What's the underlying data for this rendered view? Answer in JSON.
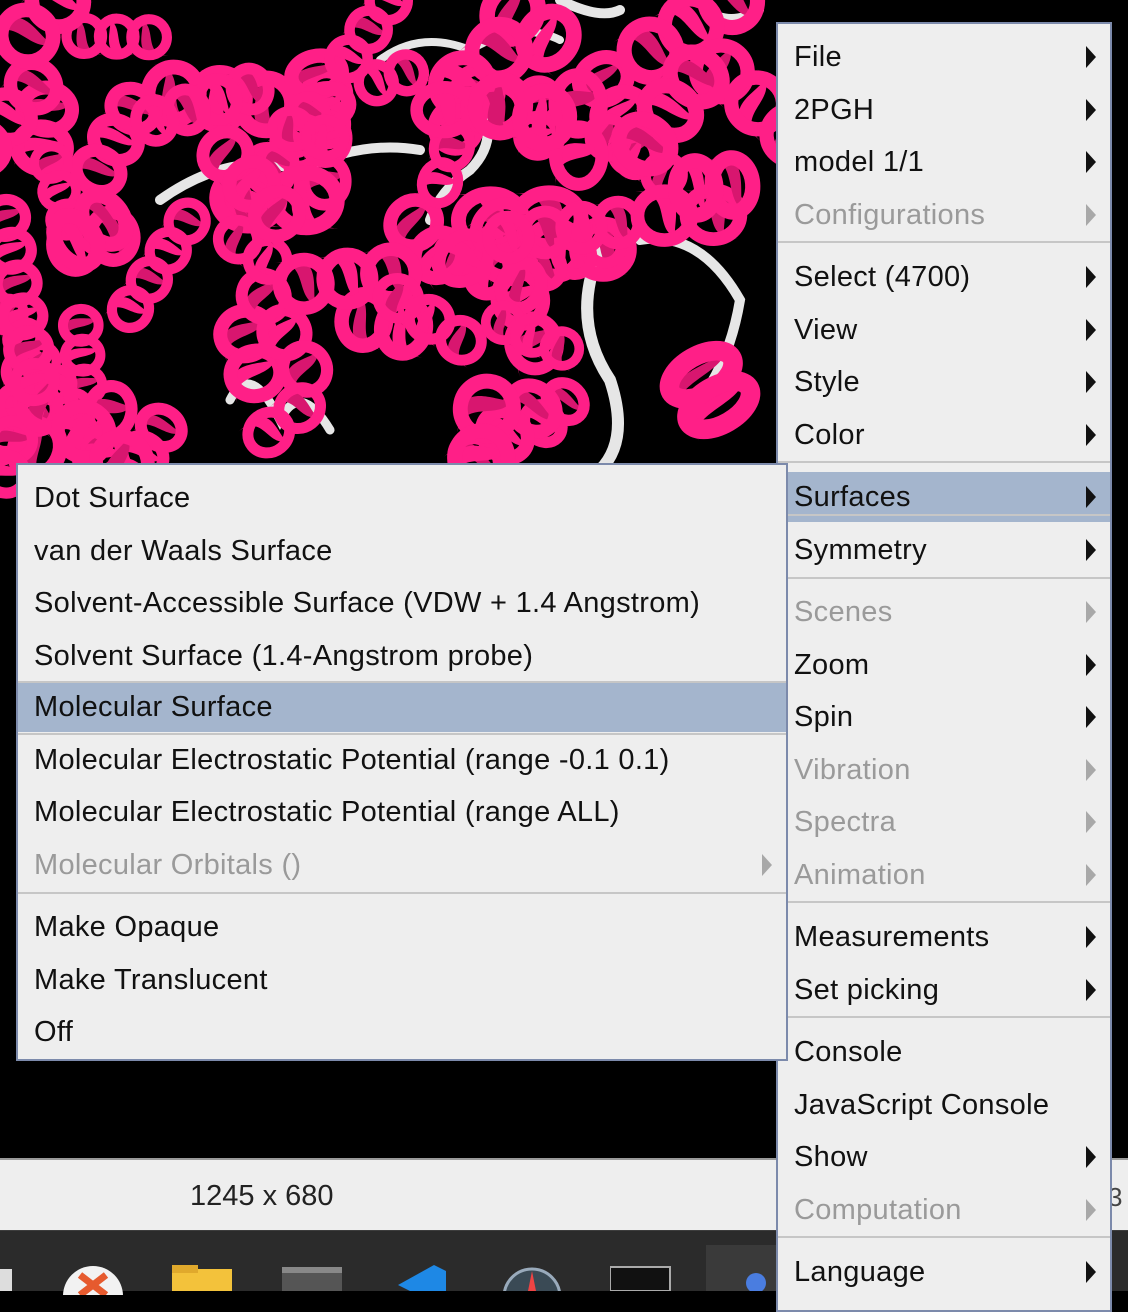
{
  "main_menu": {
    "items": [
      {
        "label": "File",
        "submenu": true,
        "enabled": true
      },
      {
        "label": "2PGH",
        "submenu": true,
        "enabled": true
      },
      {
        "label": "model 1/1",
        "submenu": true,
        "enabled": true
      },
      {
        "label": "Configurations",
        "submenu": true,
        "enabled": false
      },
      {
        "label": "Select (4700)",
        "submenu": true,
        "enabled": true
      },
      {
        "label": "View",
        "submenu": true,
        "enabled": true
      },
      {
        "label": "Style",
        "submenu": true,
        "enabled": true
      },
      {
        "label": "Color",
        "submenu": true,
        "enabled": true
      },
      {
        "label": "Surfaces",
        "submenu": true,
        "enabled": true,
        "highlighted": true
      },
      {
        "label": "Symmetry",
        "submenu": true,
        "enabled": true
      },
      {
        "label": "Scenes",
        "submenu": true,
        "enabled": false
      },
      {
        "label": "Zoom",
        "submenu": true,
        "enabled": true
      },
      {
        "label": "Spin",
        "submenu": true,
        "enabled": true
      },
      {
        "label": "Vibration",
        "submenu": true,
        "enabled": false
      },
      {
        "label": "Spectra",
        "submenu": true,
        "enabled": false
      },
      {
        "label": "Animation",
        "submenu": true,
        "enabled": false
      },
      {
        "label": "Measurements",
        "submenu": true,
        "enabled": true
      },
      {
        "label": "Set picking",
        "submenu": true,
        "enabled": true
      },
      {
        "label": "Console",
        "submenu": false,
        "enabled": true
      },
      {
        "label": "JavaScript Console",
        "submenu": false,
        "enabled": true
      },
      {
        "label": "Show",
        "submenu": true,
        "enabled": true
      },
      {
        "label": "Computation",
        "submenu": true,
        "enabled": false
      },
      {
        "label": "Language",
        "submenu": true,
        "enabled": true
      }
    ]
  },
  "surfaces_submenu": {
    "items": [
      {
        "label": "Dot Surface",
        "submenu": false,
        "enabled": true
      },
      {
        "label": "van der Waals Surface",
        "submenu": false,
        "enabled": true
      },
      {
        "label": "Solvent-Accessible Surface (VDW + 1.4 Angstrom)",
        "submenu": false,
        "enabled": true
      },
      {
        "label": "Solvent Surface (1.4-Angstrom probe)",
        "submenu": false,
        "enabled": true
      },
      {
        "label": "Molecular Surface",
        "submenu": false,
        "enabled": true,
        "highlighted": true
      },
      {
        "label": "Molecular Electrostatic Potential (range -0.1 0.1)",
        "submenu": false,
        "enabled": true
      },
      {
        "label": "Molecular Electrostatic Potential (range ALL)",
        "submenu": false,
        "enabled": true
      },
      {
        "label": "Molecular Orbitals ()",
        "submenu": true,
        "enabled": false
      },
      {
        "label": "Make Opaque",
        "submenu": false,
        "enabled": true
      },
      {
        "label": "Make Translucent",
        "submenu": false,
        "enabled": true
      },
      {
        "label": "Off",
        "submenu": false,
        "enabled": true
      }
    ]
  },
  "status_bar": {
    "size_text": "1245 x 680",
    "right_text": "3"
  },
  "colors": {
    "ribbon_helix": "#ff1f87",
    "ribbon_coil": "#e6e6e6",
    "background": "#000000",
    "menu_bg": "#eeeeee",
    "highlight": "#a4b5cd",
    "disabled_text": "#9a9a9a"
  },
  "taskbar": {
    "icons": [
      "app-x-icon",
      "folder-icon",
      "terminal-icon",
      "vscode-icon",
      "compass-app-icon",
      "console-app-icon",
      "jmol-app-icon"
    ]
  }
}
